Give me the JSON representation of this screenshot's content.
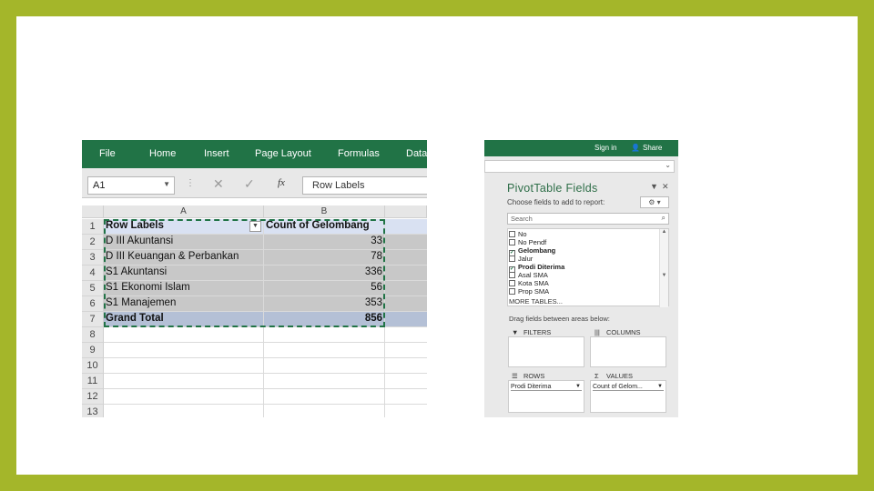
{
  "excel": {
    "ribbon_tabs": [
      "File",
      "Home",
      "Insert",
      "Page Layout",
      "Formulas",
      "Data"
    ],
    "name_box": "A1",
    "fx_label": "fx",
    "formula_value": "Row Labels",
    "columns": [
      "A",
      "B"
    ],
    "row_numbers": [
      "1",
      "2",
      "3",
      "4",
      "5",
      "6",
      "7",
      "8",
      "9",
      "10",
      "11",
      "12",
      "13"
    ],
    "header": {
      "a": "Row Labels",
      "b": "Count of Gelombang"
    },
    "rows": [
      {
        "a": "D III Akuntansi",
        "b": "33"
      },
      {
        "a": "D III Keuangan & Perbankan",
        "b": "78"
      },
      {
        "a": "S1 Akuntansi",
        "b": "336"
      },
      {
        "a": "S1 Ekonomi Islam",
        "b": "56"
      },
      {
        "a": "S1 Manajemen",
        "b": "353"
      }
    ],
    "total": {
      "a": "Grand Total",
      "b": "856"
    }
  },
  "pivot": {
    "top_bar": {
      "sign_in": "Sign in",
      "share": "Share"
    },
    "title": "PivotTable Fields",
    "choose_label": "Choose fields to add to report:",
    "search_placeholder": "Search",
    "fields": [
      {
        "name": "No",
        "checked": false
      },
      {
        "name": "No Pendf",
        "checked": false
      },
      {
        "name": "Gelombang",
        "checked": true
      },
      {
        "name": "Jalur",
        "checked": false
      },
      {
        "name": "Prodi Diterima",
        "checked": true
      },
      {
        "name": "Asal SMA",
        "checked": false
      },
      {
        "name": "Kota SMA",
        "checked": false
      },
      {
        "name": "Prop SMA",
        "checked": false
      }
    ],
    "more_tables": "MORE TABLES...",
    "drag_label": "Drag fields between areas below:",
    "areas": {
      "filters": "FILTERS",
      "columns": "COLUMNS",
      "rows": "ROWS",
      "values": "VALUES",
      "rows_chip": "Prodi Diterima",
      "values_chip": "Count of Gelom..."
    }
  }
}
